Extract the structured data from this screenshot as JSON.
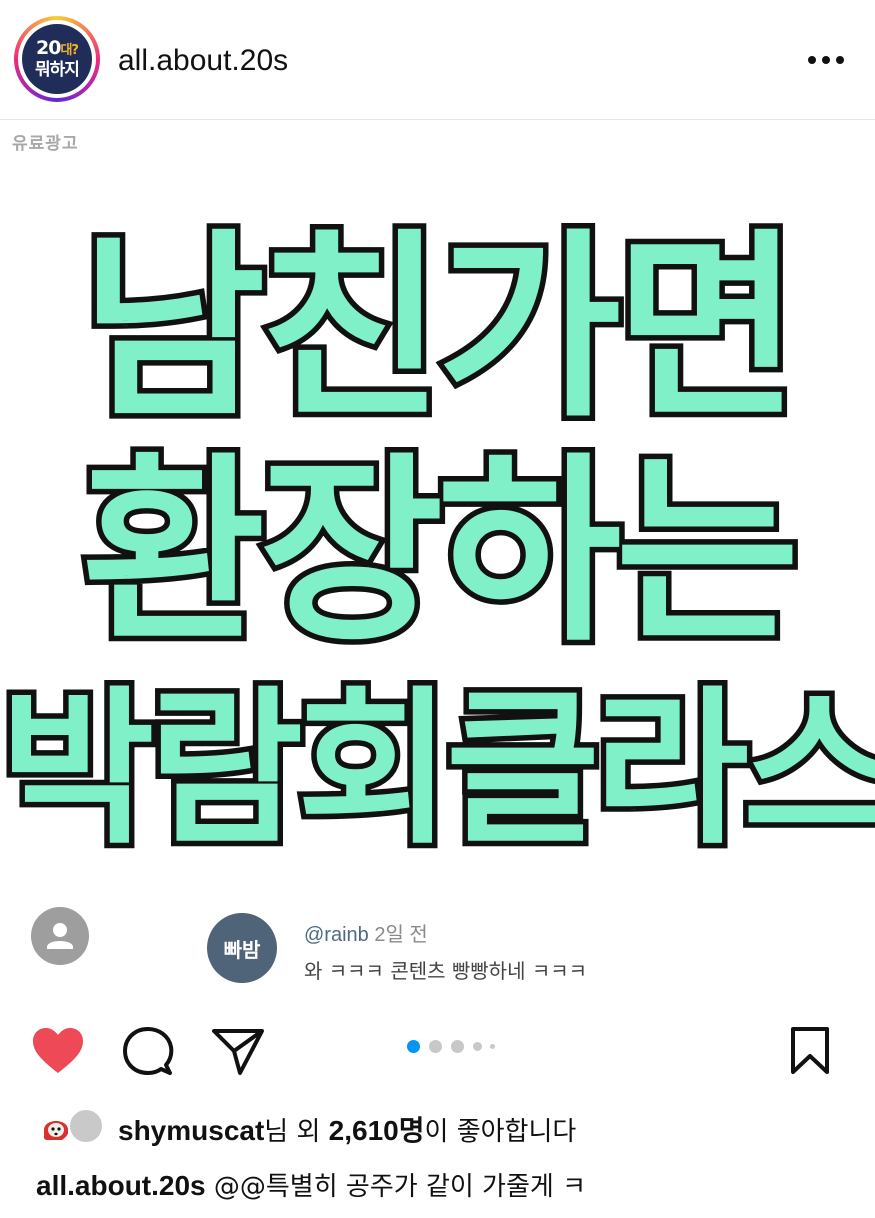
{
  "header": {
    "logo": {
      "line1": "20",
      "line1_mark": "대?",
      "line2": "뭐하지",
      "bg_color": "#1f2d58",
      "accent_color": "#f5b324"
    },
    "username": "all.about.20s",
    "more_icon": "more-horizontal-icon"
  },
  "post": {
    "sponsored_label": "유료광고",
    "headline": {
      "line1": "남친가면",
      "line2": "환장하는",
      "line3": "박람회클라스",
      "fill_color": "#7ff0c8",
      "stroke_color": "#111111"
    },
    "profile_icon": "user-silhouette-icon",
    "comment": {
      "avatar_text": "빠밤",
      "handle": "@rainb",
      "time": "2일 전",
      "text": "와 ㅋㅋㅋ 콘텐츠 빵빵하네 ㅋㅋㅋ"
    }
  },
  "actions": {
    "like_icon": "heart-filled-icon",
    "comment_icon": "comment-bubble-icon",
    "share_icon": "send-paper-plane-icon",
    "save_icon": "bookmark-icon",
    "like_color": "#ed4956",
    "carousel": {
      "count": 5,
      "active_index": 0,
      "active_color": "#0095f6"
    }
  },
  "likes": {
    "user": "shymuscat",
    "mid": "님 외 ",
    "count": "2,610명",
    "suffix": "이 좋아합니다"
  },
  "caption": {
    "username": "all.about.20s",
    "text": " @@특별히 공주가 같이 가줄게 ㅋ"
  }
}
